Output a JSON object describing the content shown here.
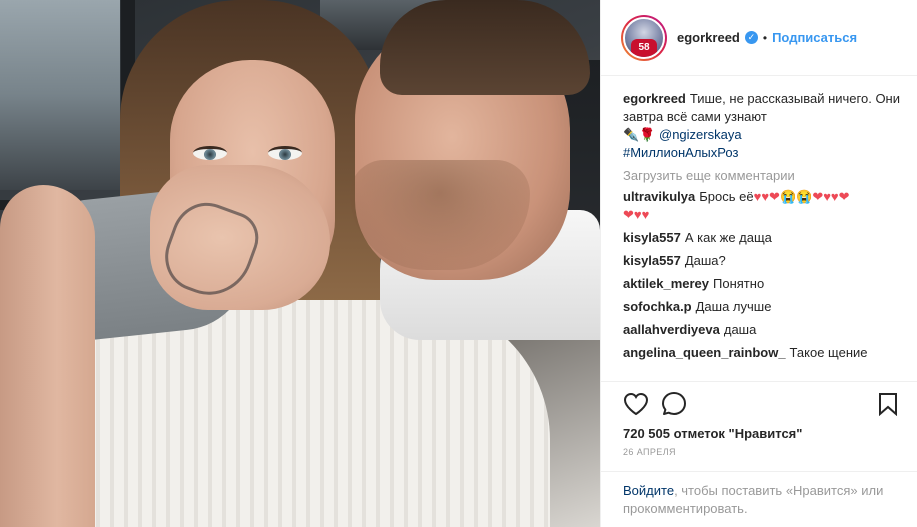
{
  "post": {
    "author": {
      "username": "egorkreed",
      "verified": true,
      "avatar_jersey_number": "58",
      "follow_label": "Подписаться",
      "separator": "•"
    },
    "caption": {
      "username": "egorkreed",
      "text": "Тише, не рассказывай ничего. Они завтра всё сами узнают",
      "emoji": "✒️🌹",
      "mention": "@ngizerskaya",
      "hashtag": "#МиллионАлыхРоз"
    },
    "load_more_label": "Загрузить еще комментарии",
    "comments": [
      {
        "username": "ultravikulya",
        "text": "Брось её",
        "hearts_line1": "♥♥❤😭😭❤♥♥❤",
        "hearts_line2": "❤♥♥"
      },
      {
        "username": "kisyla557",
        "text": "А как же даща"
      },
      {
        "username": "kisyla557",
        "text": "Даша?"
      },
      {
        "username": "aktilek_merey",
        "text": "Понятно"
      },
      {
        "username": "sofochka.p",
        "text": "Даша лучше"
      },
      {
        "username": "aallahverdiyeva",
        "text": "даша"
      },
      {
        "username": "angelina_queen_rainbow_",
        "text": "Такое щение"
      }
    ],
    "actions": {
      "like_icon": "heart-icon",
      "comment_icon": "comment-icon",
      "save_icon": "bookmark-icon"
    },
    "likes": {
      "count": "720 505",
      "label": "отметок \"Нравится\""
    },
    "date": "26 АПРЕЛЯ",
    "login_prompt": {
      "link": "Войдите",
      "text": ", чтобы поставить «Нравится» или прокомментировать."
    },
    "colors": {
      "accent": "#3897f0",
      "link": "#003569",
      "muted": "#999999",
      "heart_red": "#ed4956"
    }
  }
}
